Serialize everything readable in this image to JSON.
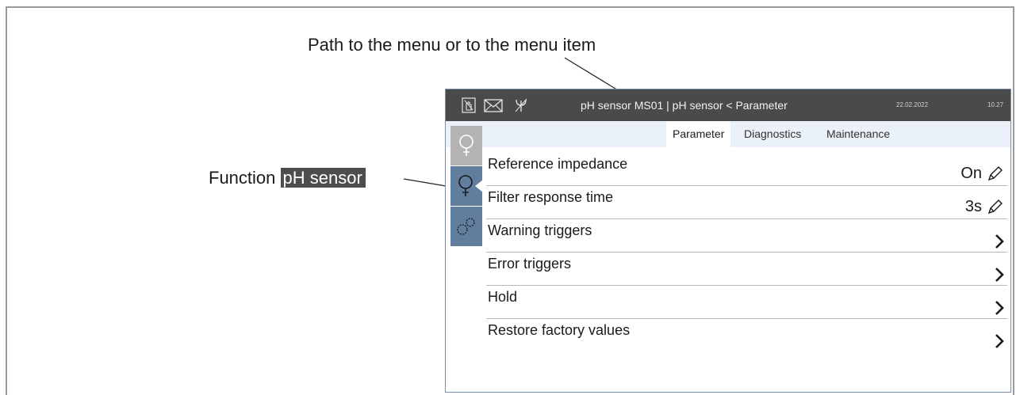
{
  "callouts": {
    "path": "Path to the menu or to the menu item",
    "function_prefix": "Function",
    "function_highlight": "pH sensor"
  },
  "status_icons": [
    "hand-lock-icon",
    "message-envelope-icon",
    "antenna-signal-icon"
  ],
  "header": {
    "title": "pH sensor MS01 | pH sensor < Parameter",
    "date": "22.02.2022",
    "time": "10.27"
  },
  "tabs": [
    {
      "label": "Parameter",
      "active": true
    },
    {
      "label": "Diagnostics",
      "active": false
    },
    {
      "label": "Maintenance",
      "active": false
    }
  ],
  "side_buttons": [
    {
      "name": "sensor-probe-icon",
      "state": "inactive"
    },
    {
      "name": "sensor-probe-icon",
      "state": "selected"
    },
    {
      "name": "gears-icon",
      "state": "inactive"
    }
  ],
  "rows": [
    {
      "label": "Reference impedance",
      "value": "On",
      "action": "edit-pencil-icon"
    },
    {
      "label": "Filter response time",
      "value": "3s",
      "action": "edit-pencil-icon"
    },
    {
      "label": "Warning triggers",
      "value": "",
      "action": "chevron-right-icon"
    },
    {
      "label": "Error triggers",
      "value": "",
      "action": "chevron-right-icon"
    },
    {
      "label": "Hold",
      "value": "",
      "action": "chevron-right-icon"
    },
    {
      "label": "Restore factory values",
      "value": "",
      "action": "chevron-right-icon"
    }
  ],
  "colors": {
    "topbar": "#4a4a4a",
    "tabbar": "#eaf1f8",
    "side_blue": "#627e9e",
    "side_gray": "#b3b3b3",
    "highlight": "#4d4d4d"
  }
}
